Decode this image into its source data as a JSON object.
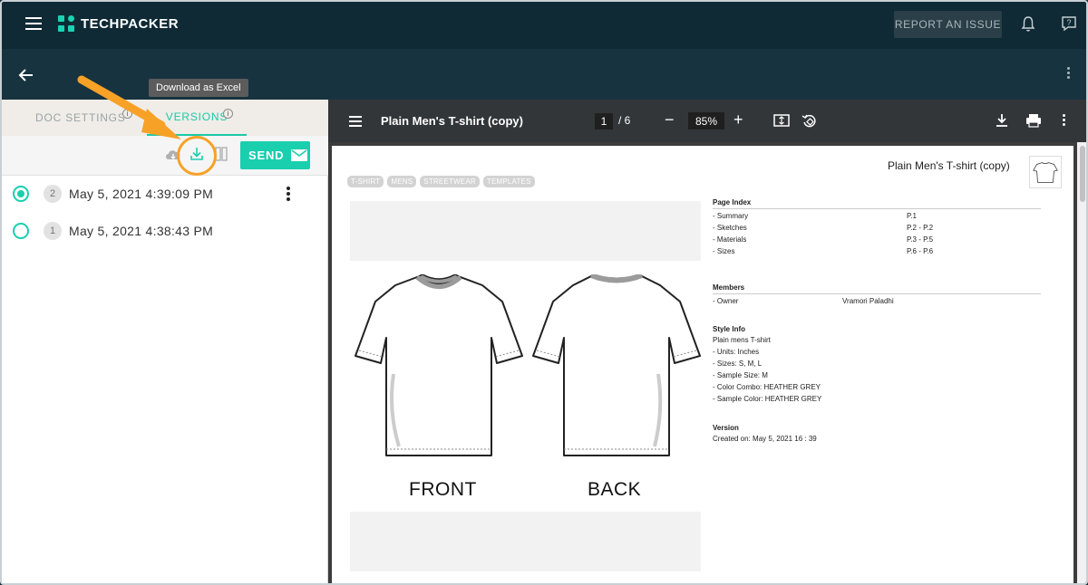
{
  "app": {
    "brand": "TECHPACKER"
  },
  "header": {
    "report_label": "REPORT AN ISSUE"
  },
  "left_panel": {
    "tabs": [
      {
        "label": "DOC SETTINGS"
      },
      {
        "label": "VERSIONS"
      }
    ],
    "send_label": "SEND",
    "tooltip": "Download as Excel",
    "versions": [
      {
        "number": "2",
        "date": "May 5, 2021 4:39:09 PM",
        "selected": true
      },
      {
        "number": "1",
        "date": "May 5, 2021 4:38:43 PM",
        "selected": false
      }
    ]
  },
  "viewer": {
    "title": "Plain Men's T-shirt (copy)",
    "page_current": "1",
    "page_total": "/ 6",
    "zoom": "85%"
  },
  "document": {
    "title": "Plain Men's T-shirt (copy)",
    "tags": [
      "T-SHIRT",
      "MENS",
      "STREETWEAR",
      "TEMPLATES"
    ],
    "front_label": "FRONT",
    "back_label": "BACK",
    "page_index": {
      "heading": "Page Index",
      "rows": [
        {
          "name": "- Summary",
          "page": "P.1"
        },
        {
          "name": "- Sketches",
          "page": "P.2 - P.2"
        },
        {
          "name": "- Materials",
          "page": "P.3 - P.5"
        },
        {
          "name": "- Sizes",
          "page": "P.6 - P.6"
        }
      ]
    },
    "members": {
      "heading": "Members",
      "rows": [
        {
          "role": "- Owner",
          "name": "Vramori Paladhi"
        }
      ]
    },
    "style_info": {
      "heading": "Style Info",
      "lines": [
        "Plain mens T-shirt",
        "- Units: Inches",
        "- Sizes: S, M, L",
        "- Sample Size: M",
        "- Color Combo: HEATHER GREY",
        "- Sample Color: HEATHER GREY"
      ]
    },
    "version": {
      "heading": "Version",
      "created": "Created on: May 5, 2021 16 : 39"
    }
  },
  "colors": {
    "accent": "#19cfae",
    "topbar": "#0f2a35",
    "highlight": "#f7a127"
  }
}
